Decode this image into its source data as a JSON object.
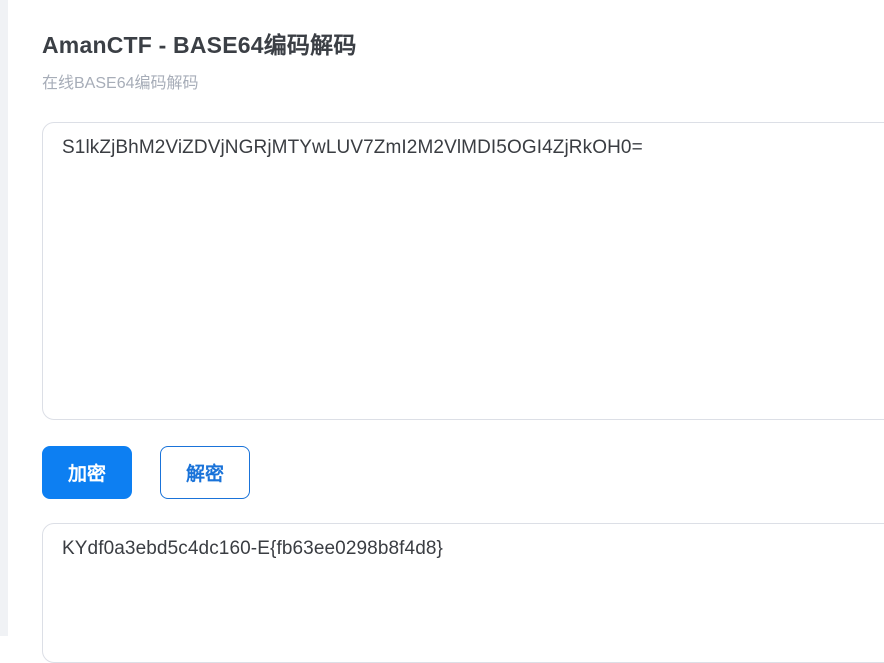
{
  "header": {
    "title": "AmanCTF - BASE64编码解码",
    "subtitle": "在线BASE64编码解码"
  },
  "input": {
    "value": "S1lkZjBhM2ViZDVjNGRjMTYwLUV7ZmI2M2VlMDI5OGI4ZjRkOH0="
  },
  "actions": {
    "encode_label": "加密",
    "decode_label": "解密"
  },
  "output": {
    "value": "KYdf0a3ebd5c4dc160-E{fb63ee0298b8f4d8}"
  },
  "colors": {
    "accent": "#0d7ff2",
    "decode_border": "#1a73d9",
    "title_text": "#3b3f45",
    "subtitle_text": "#a7adb8",
    "box_border": "#dcdfe6"
  }
}
